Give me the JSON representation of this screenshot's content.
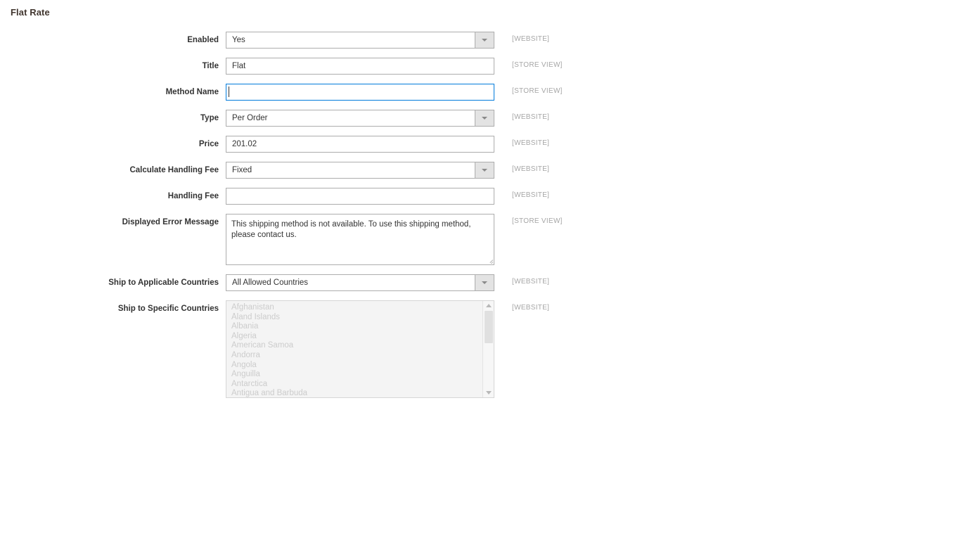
{
  "section": {
    "title": "Flat Rate"
  },
  "scopes": {
    "website": "[WEBSITE]",
    "store_view": "[STORE VIEW]"
  },
  "fields": {
    "enabled": {
      "label": "Enabled",
      "value": "Yes",
      "scope": "[WEBSITE]",
      "type": "select"
    },
    "title": {
      "label": "Title",
      "value": "Flat",
      "scope": "[STORE VIEW]",
      "type": "text"
    },
    "method_name": {
      "label": "Method Name",
      "value": "",
      "scope": "[STORE VIEW]",
      "type": "text",
      "focused": true
    },
    "type": {
      "label": "Type",
      "value": "Per Order",
      "scope": "[WEBSITE]",
      "type": "select"
    },
    "price": {
      "label": "Price",
      "value": "201.02",
      "scope": "[WEBSITE]",
      "type": "text"
    },
    "calculate_handling_fee": {
      "label": "Calculate Handling Fee",
      "value": "Fixed",
      "scope": "[WEBSITE]",
      "type": "select"
    },
    "handling_fee": {
      "label": "Handling Fee",
      "value": "",
      "scope": "[WEBSITE]",
      "type": "text"
    },
    "displayed_error_message": {
      "label": "Displayed Error Message",
      "value": "This shipping method is not available. To use this shipping method, please contact us.",
      "scope": "[STORE VIEW]",
      "type": "textarea"
    },
    "ship_to_applicable_countries": {
      "label": "Ship to Applicable Countries",
      "value": "All Allowed Countries",
      "scope": "[WEBSITE]",
      "type": "select"
    },
    "ship_to_specific_countries": {
      "label": "Ship to Specific Countries",
      "scope": "[WEBSITE]",
      "type": "multiselect",
      "disabled": true,
      "options": [
        "Afghanistan",
        "Åland Islands",
        "Albania",
        "Algeria",
        "American Samoa",
        "Andorra",
        "Angola",
        "Anguilla",
        "Antarctica",
        "Antigua and Barbuda"
      ]
    }
  },
  "colors": {
    "focus_border": "#007bdb",
    "label_text": "#333333",
    "scope_text": "#a6a6a6",
    "heading_text": "#41362f",
    "disabled_text": "#cccccc"
  }
}
